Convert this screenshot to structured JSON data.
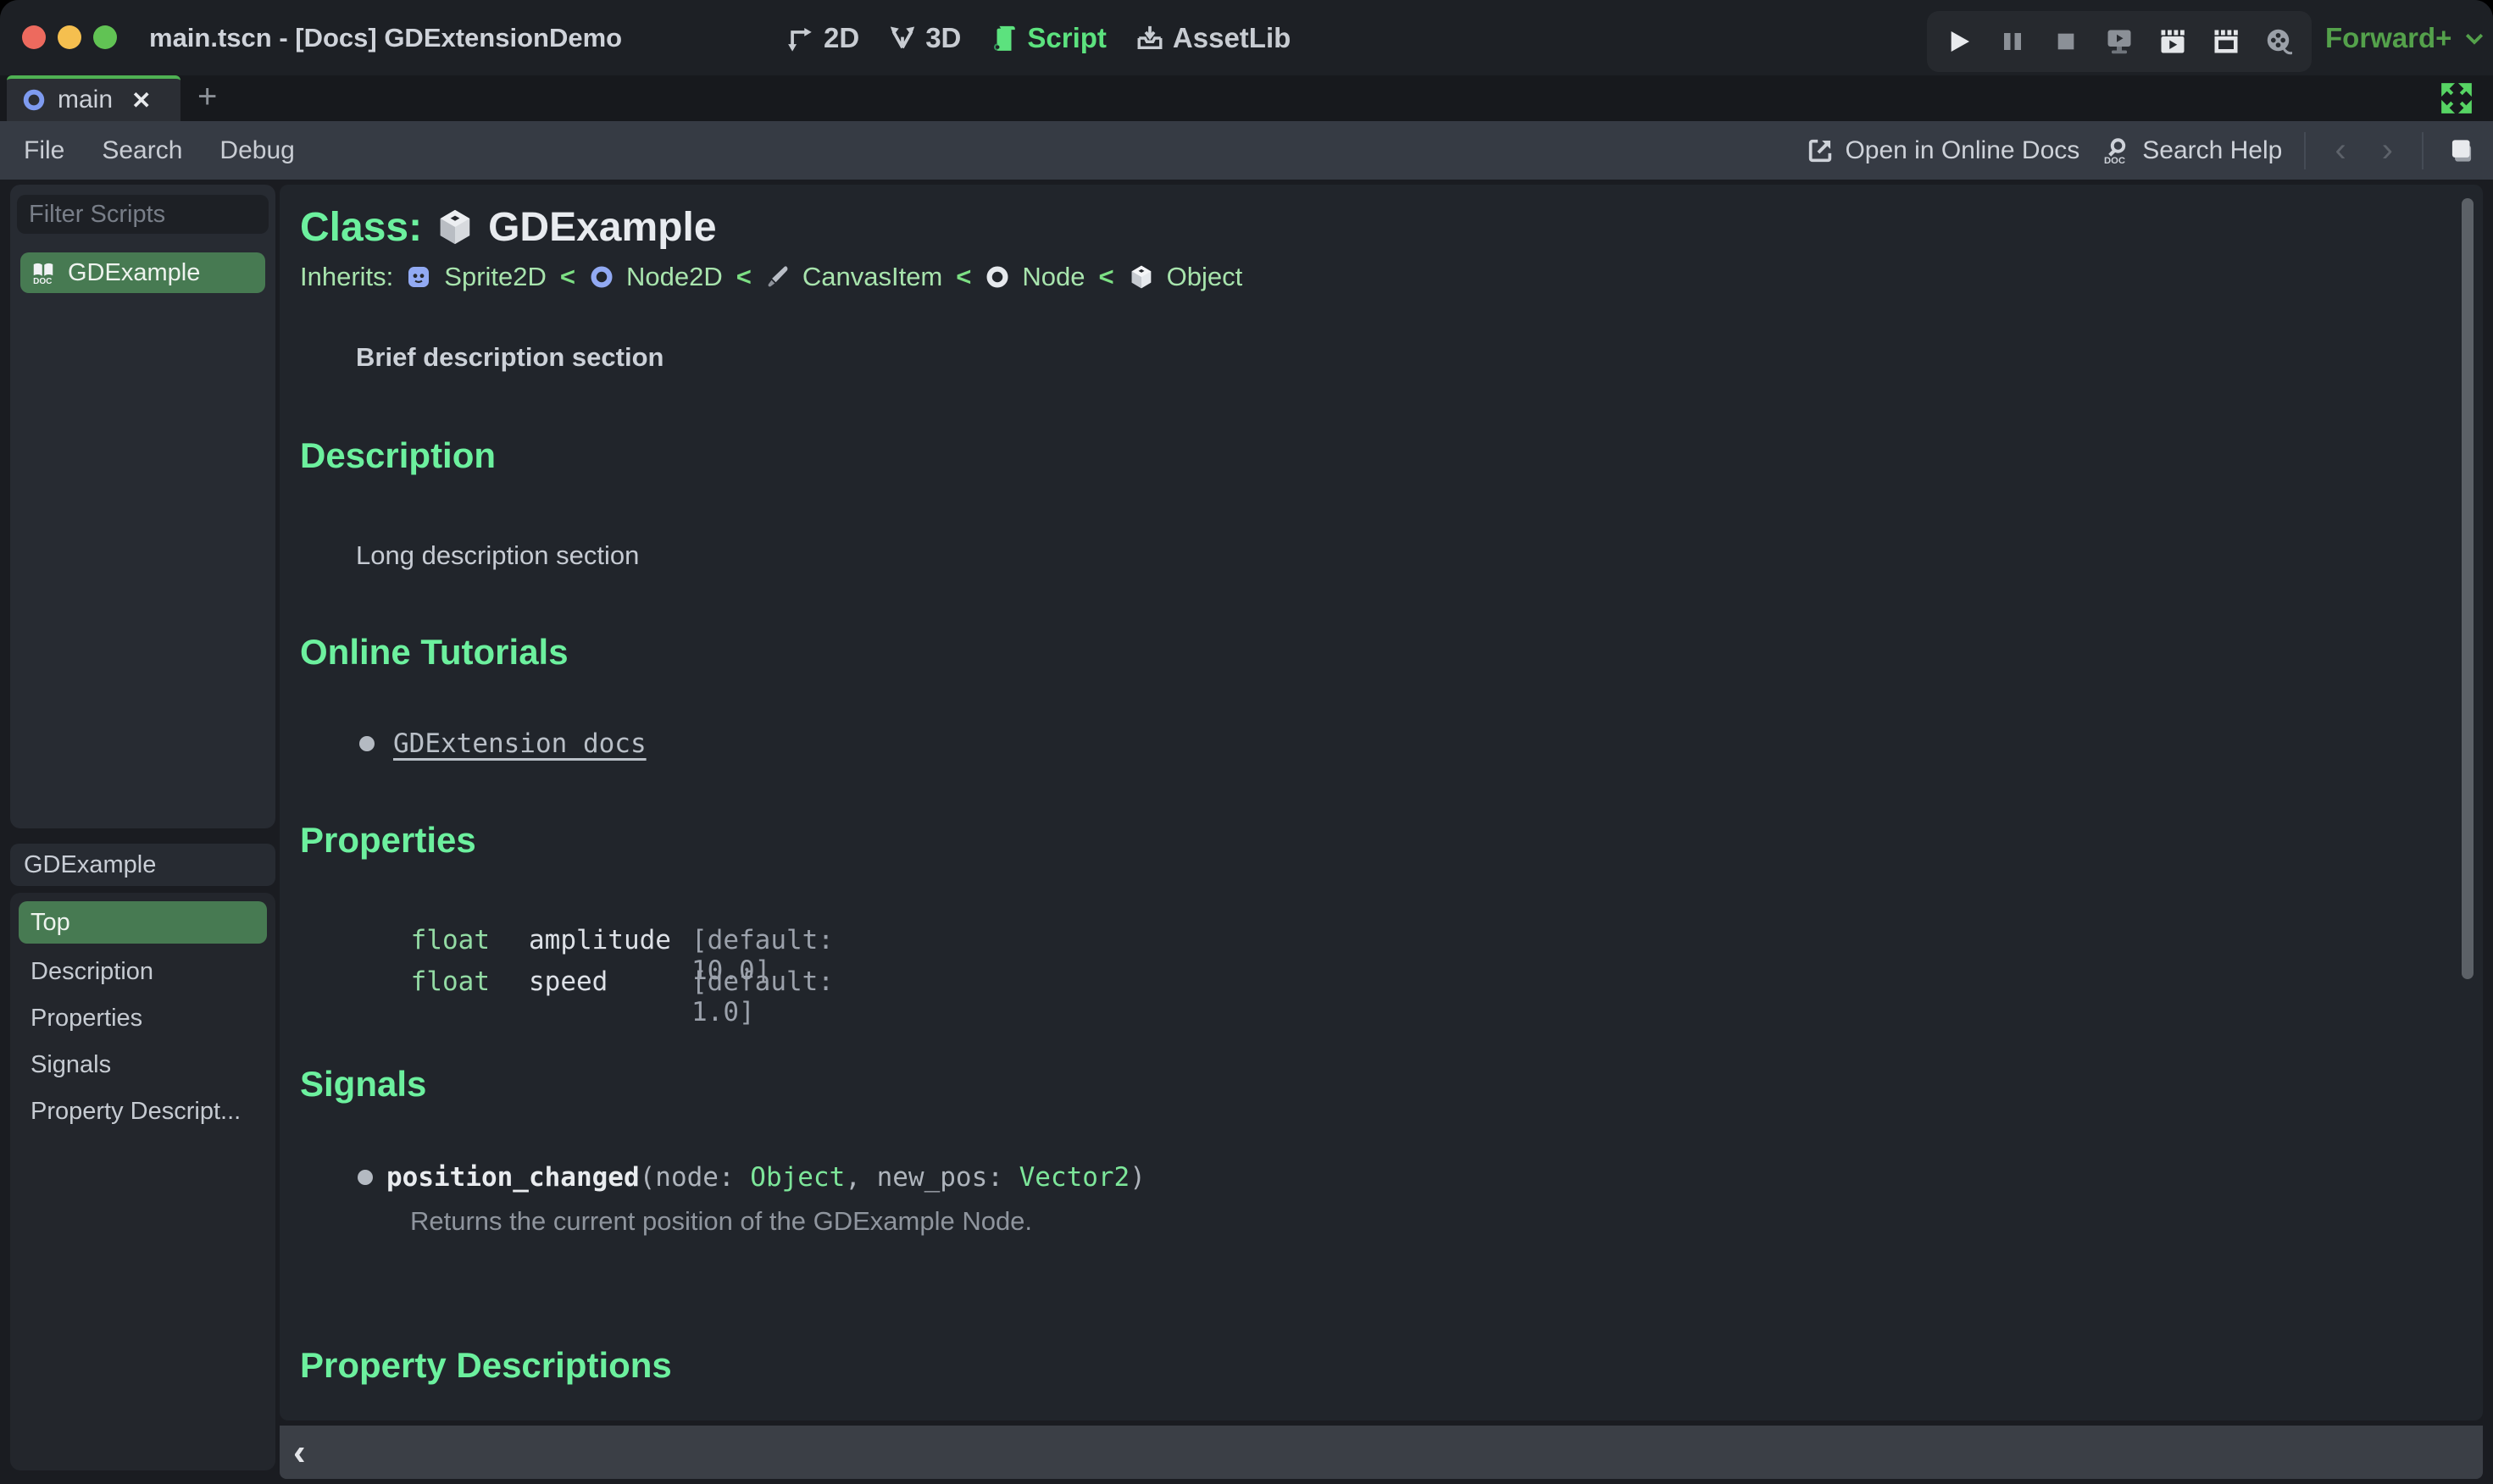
{
  "window": {
    "title": "main.tscn - [Docs] GDExtensionDemo"
  },
  "topbar": {
    "workspaces": [
      {
        "label": "2D",
        "active": false
      },
      {
        "label": "3D",
        "active": false
      },
      {
        "label": "Script",
        "active": true
      },
      {
        "label": "AssetLib",
        "active": false
      }
    ],
    "renderer": {
      "label": "Forward+"
    }
  },
  "tabbar": {
    "tabs": [
      {
        "label": "main"
      }
    ]
  },
  "glyphs": {
    "close": "✕",
    "plus": "+",
    "nav_back": "‹",
    "nav_forward": "›",
    "collapse": "‹"
  },
  "menubar": {
    "items": [
      "File",
      "Search",
      "Debug"
    ],
    "open_online_docs": "Open in Online Docs",
    "search_help": "Search Help"
  },
  "scripts_panel": {
    "filter_placeholder": "Filter Scripts",
    "items": [
      {
        "label": "GDExample",
        "selected": true
      }
    ]
  },
  "members_panel": {
    "title": "GDExample",
    "items": [
      "Top",
      "Description",
      "Properties",
      "Signals",
      "Property Descript..."
    ],
    "selected": "Top"
  },
  "doc": {
    "class_label": "Class:",
    "class_name": "GDExample",
    "inherits_label": "Inherits:",
    "inherits_separator": "<",
    "inherits": [
      {
        "name": "Sprite2D"
      },
      {
        "name": "Node2D"
      },
      {
        "name": "CanvasItem"
      },
      {
        "name": "Node"
      },
      {
        "name": "Object"
      }
    ],
    "brief": "Brief description section",
    "description_heading": "Description",
    "description_body": "Long description section",
    "tutorials_heading": "Online Tutorials",
    "tutorial_link": "GDExtension docs",
    "properties_heading": "Properties",
    "properties": [
      {
        "type": "float",
        "name": "amplitude",
        "default": "[default: 10.0]"
      },
      {
        "type": "float",
        "name": "speed",
        "default": "[default: 1.0]"
      }
    ],
    "signals_heading": "Signals",
    "signal": {
      "name": "position_changed",
      "sig_open": "(node: ",
      "type1": "Object",
      "sig_mid": ", new_pos: ",
      "type2": "Vector2",
      "sig_close": ")",
      "description": "Returns the current position of the GDExample Node."
    },
    "property_descriptions_heading": "Property Descriptions"
  },
  "colors": {
    "accent_green": "#6cf09e",
    "selection_green": "#477a52",
    "tab_border_green": "#4fb153",
    "renderer_green": "#54a14b",
    "script_green": "#5ce27e",
    "content_bg": "#21252b",
    "panel_bg": "#272b32",
    "menubar_bg": "#363b44"
  }
}
